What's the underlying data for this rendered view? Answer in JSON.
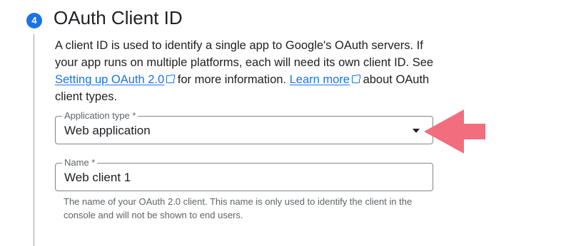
{
  "step": {
    "number": "4",
    "title": "OAuth Client ID"
  },
  "description": {
    "part1": "A client ID is used to identify a single app to Google's OAuth servers. If your app runs on multiple platforms, each will need its own client ID. See ",
    "link1_label": "Setting up OAuth 2.0",
    "part2": " for more information. ",
    "link2_label": "Learn more",
    "part3": " about OAuth client types."
  },
  "application_type": {
    "label": "Application type *",
    "value": "Web application"
  },
  "name_field": {
    "label": "Name *",
    "value": "Web client 1",
    "hint": "The name of your OAuth 2.0 client. This name is only used to identify the client in the console and will not be shown to end users."
  },
  "icons": {
    "external_link": "external-link-icon",
    "dropdown": "dropdown-caret-icon",
    "annotation": "pointer-arrow-icon"
  },
  "colors": {
    "accent": "#1a73e8",
    "annotation_arrow": "#f26d7d",
    "text": "#202124",
    "secondary_text": "#5f6368",
    "border": "#80868b"
  }
}
